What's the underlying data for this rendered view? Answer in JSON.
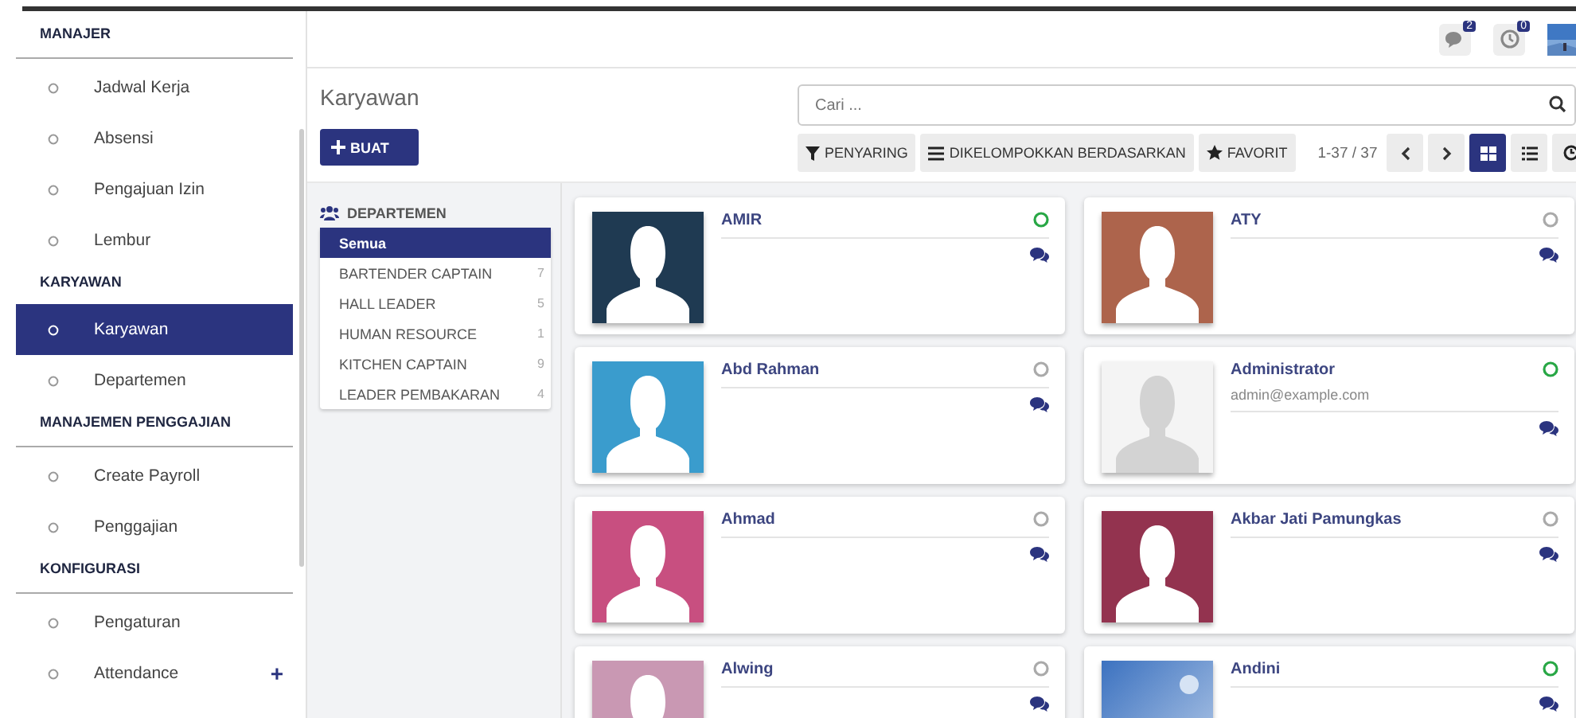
{
  "sidebar": {
    "sections": [
      {
        "title": "MANAJER",
        "divider": true,
        "items": [
          {
            "label": "Jadwal Kerja",
            "selected": false
          },
          {
            "label": "Absensi",
            "selected": false
          },
          {
            "label": "Pengajuan Izin",
            "selected": false
          },
          {
            "label": "Lembur",
            "selected": false
          }
        ]
      },
      {
        "title": "KARYAWAN",
        "divider": false,
        "items": [
          {
            "label": "Karyawan",
            "selected": true
          },
          {
            "label": "Departemen",
            "selected": false
          }
        ]
      },
      {
        "title": "MANAJEMEN PENGGAJIAN",
        "divider": true,
        "items": [
          {
            "label": "Create Payroll",
            "selected": false
          },
          {
            "label": "Penggajian",
            "selected": false
          }
        ]
      },
      {
        "title": "KONFIGURASI",
        "divider": true,
        "items": [
          {
            "label": "Pengaturan",
            "selected": false
          },
          {
            "label": "Attendance",
            "selected": false,
            "expand": "+"
          }
        ]
      }
    ]
  },
  "topbar": {
    "messages_count": "2",
    "activities_count": "0"
  },
  "page": {
    "title": "Karyawan",
    "create_button": "BUAT",
    "search": {
      "placeholder": "Cari ..."
    },
    "filters": [
      {
        "label": "PENYARING",
        "kind": "filter"
      },
      {
        "label": "DIKELOMPOKKAN BERDASARKAN",
        "kind": "group"
      },
      {
        "label": "FAVORIT",
        "kind": "star"
      }
    ],
    "pager": "1-37 / 37",
    "views": [
      {
        "kind": "kanban",
        "selected": true
      },
      {
        "kind": "list",
        "selected": false
      },
      {
        "kind": "activity",
        "selected": false
      }
    ]
  },
  "departments": {
    "title": "DEPARTEMEN",
    "items": [
      {
        "label": "Semua",
        "selected": true
      },
      {
        "label": "BARTENDER CAPTAIN",
        "count": "7",
        "selected": false
      },
      {
        "label": "HALL LEADER",
        "count": "5",
        "selected": false
      },
      {
        "label": "HUMAN RESOURCE",
        "count": "1",
        "selected": false
      },
      {
        "label": "KITCHEN CAPTAIN",
        "count": "9",
        "selected": false
      },
      {
        "label": "LEADER PEMBAKARAN",
        "count": "4",
        "selected": false
      }
    ]
  },
  "employees": [
    {
      "name": "AMIR",
      "online": true,
      "kind": "avatar",
      "color": "#1f3a52"
    },
    {
      "name": "ATY",
      "online": false,
      "kind": "avatar",
      "color": "#ad644c"
    },
    {
      "name": "Abd Rahman",
      "online": false,
      "kind": "avatar",
      "color": "#3a9ccd"
    },
    {
      "name": "Administrator",
      "email": "admin@example.com",
      "online": true,
      "kind": "avatar",
      "color": "#f4f4f4"
    },
    {
      "name": "Ahmad",
      "online": false,
      "kind": "avatar",
      "color": "#c84f80"
    },
    {
      "name": "Akbar Jati Pamungkas",
      "online": false,
      "kind": "avatar",
      "color": "#93334f"
    },
    {
      "name": "Alwing",
      "online": false,
      "kind": "avatar",
      "color": "#c998b3"
    },
    {
      "name": "Andini",
      "online": true,
      "kind": "picture"
    }
  ]
}
